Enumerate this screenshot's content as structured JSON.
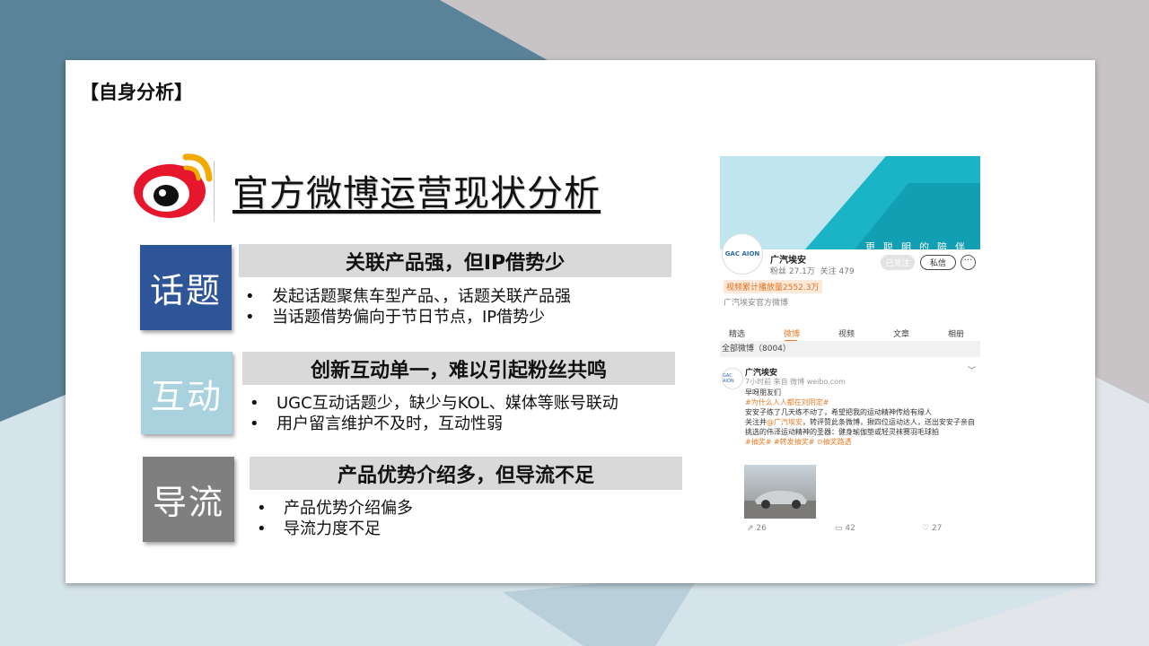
{
  "section_tag": "【自身分析】",
  "title": "官方微博运营现状分析",
  "colors": {
    "topic_tile": "#2e5597",
    "interaction_tile": "#a9d2de",
    "traffic_tile": "#7f7f7f",
    "bar_bg": "#d9d9d9",
    "accent_orange": "#e97b25"
  },
  "sections": [
    {
      "label": "话题",
      "heading": "关联产品强，但IP借势少",
      "bullets": [
        "发起话题聚焦车型产品、，话题关联产品强",
        "当话题借势偏向于节日节点，IP借势少"
      ]
    },
    {
      "label": "互动",
      "heading": "创新互动单一，难以引起粉丝共鸣",
      "bullets": [
        "UGC互动话题少，缺少与KOL、媒体等账号联动",
        "用户留言维护不及时，互动性弱"
      ]
    },
    {
      "label": "导流",
      "heading": "产品优势介绍多，但导流不足",
      "bullets": [
        "产品优势介绍偏多",
        "导流力度不足"
      ]
    }
  ],
  "weibo": {
    "banner_tagline": "更聪明的陪伴",
    "avatar_text": "GAC AION",
    "account_name": "广汽埃安",
    "fans": "粉丝 27.1万",
    "following": "关注 479",
    "followed_btn": "已关注",
    "message_btn": "私信",
    "more_btn": "···",
    "video_views": "视频累计播放量2552.3万",
    "verified": "广汽埃安官方微博",
    "tabs": [
      "精选",
      "微博",
      "视频",
      "文章",
      "相册"
    ],
    "active_tab": "微博",
    "weibo_count": "全部微博（8004）",
    "post": {
      "author": "广汽埃安",
      "meta": "7小时前 来自 微博 weibo.com",
      "line1": "早呀朋友们",
      "hashtag": "#为什么人人都在刘阴定#",
      "line2": "安安子练了几天练不动了，希望把我的运动精神传给有缘人",
      "line3a": "关注并",
      "line3b": "@广汽埃安",
      "line3c": "，转评赞此条微博，揪四位运动达人，送出安安子亲自挑选的伟泽运动精神的圣器：健身瑜伽垫或轻灵袜赛羽毛球拍",
      "line4": "#抽奖# #转发抽奖# ⊙抽奖路透",
      "reposts": "26",
      "comments": "42",
      "likes": "27"
    }
  }
}
